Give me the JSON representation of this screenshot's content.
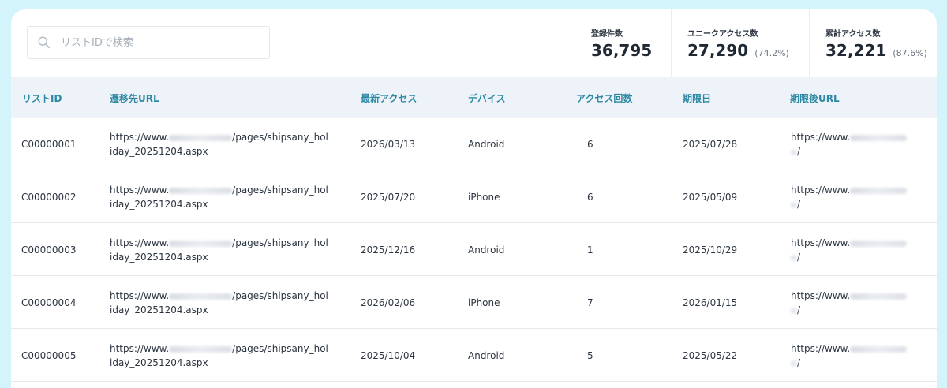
{
  "search": {
    "placeholder": "リストIDで検索",
    "value": ""
  },
  "stats": [
    {
      "label": "登録件数",
      "value": "36,795",
      "pct": ""
    },
    {
      "label": "ユニークアクセス数",
      "value": "27,290",
      "pct": "(74.2%)"
    },
    {
      "label": "累計アクセス数",
      "value": "32,221",
      "pct": "(87.6%)"
    }
  ],
  "columns": [
    "リストID",
    "遷移先URL",
    "最新アクセス",
    "デバイス",
    "アクセス回数",
    "期限日",
    "期限後URL"
  ],
  "rows": [
    {
      "id": "C00000001",
      "url_prefix": "https://www.",
      "url_suffix": "/pages/shipsany_hol",
      "url_line2": "iday_20251204.aspx",
      "latest": "2026/03/13",
      "device": "Android",
      "count": "6",
      "expiry": "2025/07/28",
      "after_prefix": "https://www.",
      "after_suffix": "/"
    },
    {
      "id": "C00000002",
      "url_prefix": "https://www.",
      "url_suffix": "/pages/shipsany_hol",
      "url_line2": "iday_20251204.aspx",
      "latest": "2025/07/20",
      "device": "iPhone",
      "count": "6",
      "expiry": "2025/05/09",
      "after_prefix": "https://www.",
      "after_suffix": "/"
    },
    {
      "id": "C00000003",
      "url_prefix": "https://www.",
      "url_suffix": "/pages/shipsany_hol",
      "url_line2": "iday_20251204.aspx",
      "latest": "2025/12/16",
      "device": "Android",
      "count": "1",
      "expiry": "2025/10/29",
      "after_prefix": "https://www.",
      "after_suffix": "/"
    },
    {
      "id": "C00000004",
      "url_prefix": "https://www.",
      "url_suffix": "/pages/shipsany_hol",
      "url_line2": "iday_20251204.aspx",
      "latest": "2026/02/06",
      "device": "iPhone",
      "count": "7",
      "expiry": "2026/01/15",
      "after_prefix": "https://www.",
      "after_suffix": "/"
    },
    {
      "id": "C00000005",
      "url_prefix": "https://www.",
      "url_suffix": "/pages/shipsany_hol",
      "url_line2": "iday_20251204.aspx",
      "latest": "2025/10/04",
      "device": "Android",
      "count": "5",
      "expiry": "2025/05/22",
      "after_prefix": "https://www.",
      "after_suffix": "/"
    }
  ],
  "icons": {
    "search": "search-icon"
  },
  "colors": {
    "accent": "#2d89a3",
    "background": "#d3f4fb",
    "header_bg": "#eef3f9"
  }
}
